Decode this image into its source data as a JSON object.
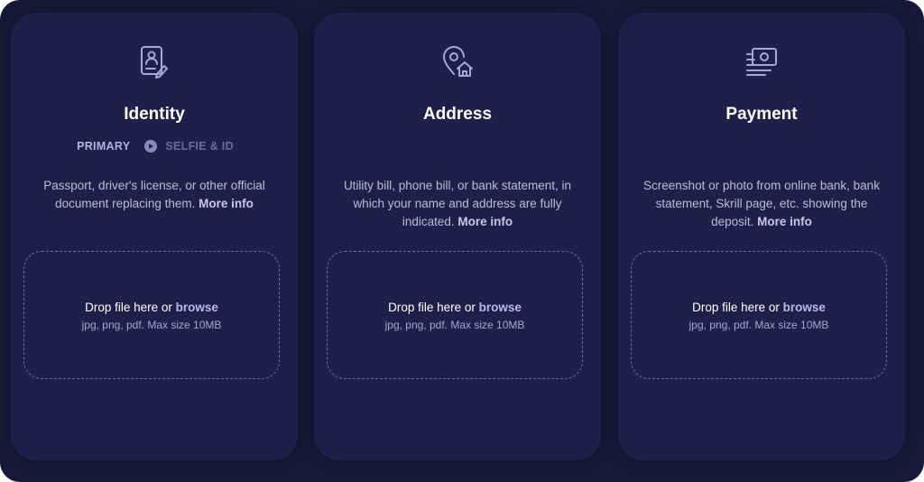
{
  "colors": {
    "background": "#181838",
    "card": "#1f1f4a",
    "icon": "#a9a6d6",
    "accent_link": "#bcb8ea"
  },
  "cards": [
    {
      "title": "Identity",
      "icon": "id-document-icon",
      "steps": {
        "primary": "PRIMARY",
        "secondary": "SELFIE & ID"
      },
      "description": "Passport, driver's license, or other official document replacing them.",
      "more_info": "More info",
      "drop_text": "Drop file here or",
      "browse": "browse",
      "hint": "jpg, png, pdf. Max size 10MB"
    },
    {
      "title": "Address",
      "icon": "location-home-icon",
      "description": "Utility bill, phone bill, or bank statement, in which your name and address are fully indicated.",
      "more_info": "More info",
      "drop_text": "Drop file here or",
      "browse": "browse",
      "hint": "jpg, png, pdf. Max size 10MB"
    },
    {
      "title": "Payment",
      "icon": "payment-screenshot-icon",
      "description": "Screenshot or photo from online bank, bank statement, Skrill page, etc. showing the deposit.",
      "more_info": "More info",
      "drop_text": "Drop file here or",
      "browse": "browse",
      "hint": "jpg, png, pdf. Max size 10MB"
    }
  ]
}
